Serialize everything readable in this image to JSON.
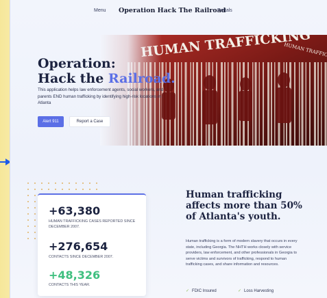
{
  "nav": {
    "menu": "Menu",
    "title": "Operation Hack The Railroad",
    "portals": "Portals"
  },
  "hero": {
    "title_line1": "Operation:",
    "title_line2_plain": "Hack the ",
    "title_line2_accent": "Railroad.",
    "description": "This application helps law enforcement agents, social workers, and parents END human trafficking by identifying high-risk locations in Atlanta",
    "primary_button": "Alert 911",
    "secondary_button": "Report a Case",
    "image_text": "HUMAN TRAFFICKING",
    "image_text_small": "HUMAN TRAFFICKING"
  },
  "stats": [
    {
      "value": "+63,380",
      "caption": "HUMAN TRAFFICKING CASES REPORTED SINCE DECEMBER 2007."
    },
    {
      "value": "+276,654",
      "caption": "CONTACTS SINCE DECEMBER 2007."
    },
    {
      "value": "+48,326",
      "caption": "CONTACTS THIS YEAR."
    }
  ],
  "info": {
    "heading": "Human trafficking affects more than 50% of Atlanta's youth.",
    "body": "Human trafficking is a form of modern slavery that occurs in every state, including Georgia. The NHTH works closely with service providers, law enforcement, and other professionals in Georgia to serve victims and survivors of trafficking, respond to human trafficking cases, and share information and resources.",
    "features": [
      "FDIC Insured",
      "Loss Harvesting"
    ]
  },
  "colors": {
    "accent": "#5b6fe6",
    "green": "#3fbf7f",
    "check": "#8fbf5a",
    "arrow": "#1e5be8"
  },
  "icons": {
    "left_arrow": "arrow-right-icon",
    "check": "check-icon"
  }
}
